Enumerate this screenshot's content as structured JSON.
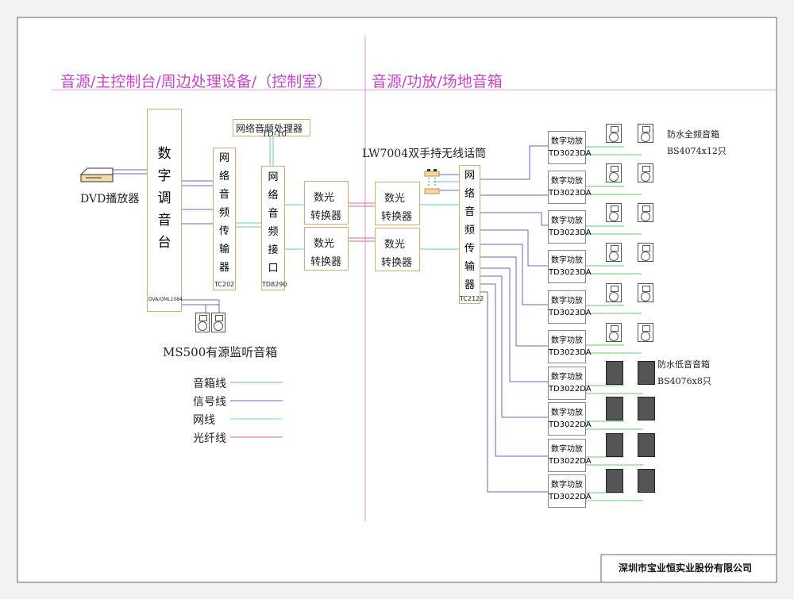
{
  "headers": {
    "left": "音源/主控制台/周边处理设备/（控制室）",
    "right": "音源/功放/场地音箱"
  },
  "devices": {
    "dvd": "DVD播放器",
    "mixer_chars": [
      "数",
      "字",
      "调",
      "音",
      "台"
    ],
    "mixer_port": "DVA/OML1084",
    "transmitter_left_chars": [
      "网",
      "络",
      "音",
      "频",
      "传",
      "输",
      "器"
    ],
    "transmitter_left_model": "TC202",
    "processor_title": "网络音频处理器",
    "processor_model": "TD-10",
    "interface_chars": [
      "网",
      "络",
      "音",
      "频",
      "接",
      "口"
    ],
    "interface_model": "TD8290",
    "converter_label": [
      "数光",
      "转换器"
    ],
    "mic_title": "LW7004双手持无线话筒",
    "transmitter_right_chars": [
      "网",
      "络",
      "音",
      "频",
      "传",
      "输",
      "器"
    ],
    "transmitter_right_model": "TC2122",
    "monitor_label": "MS500有源监听音箱"
  },
  "amplifiers": [
    {
      "name": "数字功放",
      "model": "TD3023DA"
    },
    {
      "name": "数字功放",
      "model": "TD3023DA"
    },
    {
      "name": "数字功放",
      "model": "TD3023DA"
    },
    {
      "name": "数字功放",
      "model": "TD3023DA"
    },
    {
      "name": "数字功放",
      "model": "TD3023DA"
    },
    {
      "name": "数字功放",
      "model": "TD3023DA"
    },
    {
      "name": "数字功放",
      "model": "TD3022DA"
    },
    {
      "name": "数字功放",
      "model": "TD3022DA"
    },
    {
      "name": "数字功放",
      "model": "TD3022DA"
    },
    {
      "name": "数字功放",
      "model": "TD3022DA"
    }
  ],
  "speaker_notes": {
    "full_range_name": "防水全频音箱",
    "full_range_model": "BS4074x12只",
    "sub_name": "防水低音音箱",
    "sub_model": "BS4076x8只"
  },
  "legend": [
    {
      "label": "音箱线",
      "color": "#66cc66"
    },
    {
      "label": "信号线",
      "color": "#6666cc"
    },
    {
      "label": "网线",
      "color": "#66dddd"
    },
    {
      "label": "光纤线",
      "color": "#dd6699"
    }
  ],
  "colors": {
    "header": "#cc44cc",
    "divider": "#dd88dd",
    "signal": "#6666cc",
    "speaker_line": "#66cc66",
    "network": "#55cccc",
    "fiber": "#dd6699",
    "box_border": "#e3a96b"
  },
  "company": "深圳市宝业恒实业股份有限公司"
}
